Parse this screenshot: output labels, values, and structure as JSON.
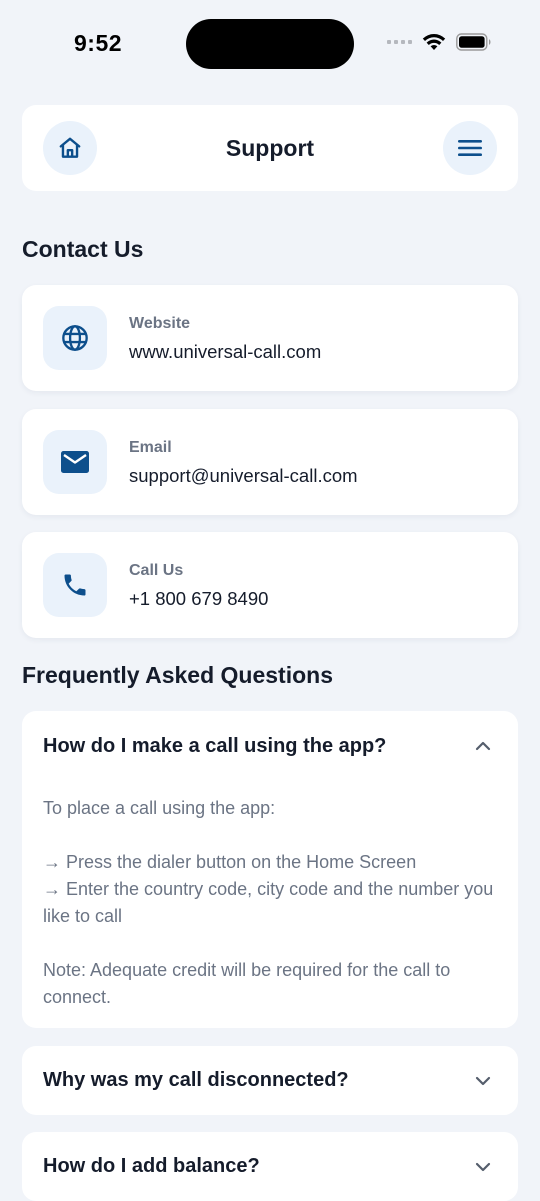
{
  "status_bar": {
    "time": "9:52"
  },
  "header": {
    "title": "Support"
  },
  "contact": {
    "section_title": "Contact Us",
    "items": [
      {
        "label": "Website",
        "value": "www.universal-call.com",
        "icon": "globe-icon"
      },
      {
        "label": "Email",
        "value": "support@universal-call.com",
        "icon": "mail-icon"
      },
      {
        "label": "Call Us",
        "value": "+1 800 679 8490",
        "icon": "phone-icon"
      }
    ]
  },
  "faq": {
    "section_title": "Frequently Asked Questions",
    "items": [
      {
        "question": "How do I make a call using the app?",
        "expanded": true,
        "answer_lines": [
          "To place a call using the app:",
          "",
          "→ Press the dialer button on the Home Screen",
          "→ Enter the country code, city code and the number you like to call",
          "",
          "Note: Adequate credit will be required for the call to connect."
        ]
      },
      {
        "question": "Why was my call disconnected?",
        "expanded": false
      },
      {
        "question": "How do I add balance?",
        "expanded": false
      }
    ]
  },
  "colors": {
    "accent": "#0d4f8c",
    "icon_bg": "#eaf2fb",
    "page_bg": "#f1f4f9"
  }
}
